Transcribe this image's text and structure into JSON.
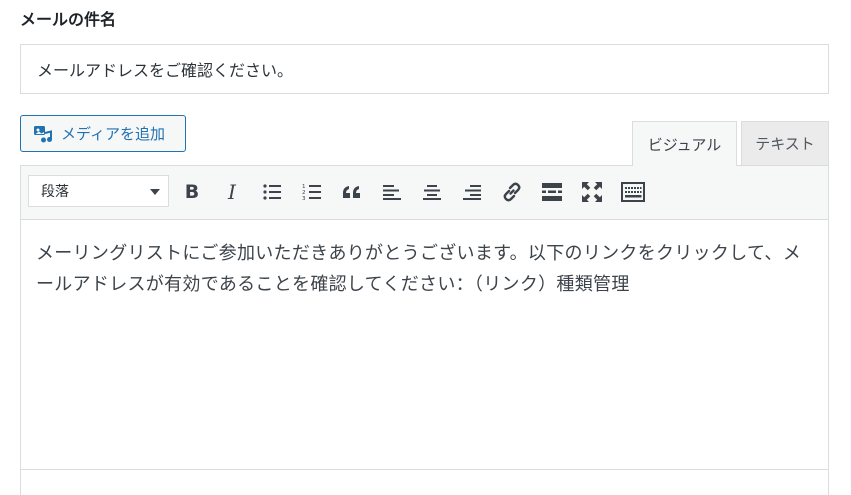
{
  "subject": {
    "label": "メールの件名",
    "value": "メールアドレスをご確認ください。"
  },
  "media": {
    "add_label": "メディアを追加"
  },
  "tabs": {
    "visual": "ビジュアル",
    "text": "テキスト"
  },
  "toolbar": {
    "format_selected": "段落",
    "bold_glyph": "B",
    "italic_glyph": "I"
  },
  "content": {
    "body": "メーリングリストにご参加いただきありがとうございます。以下のリンクをクリックして、メールアドレスが有効であることを確認してください：（リンク）種類管理"
  },
  "colors": {
    "accent": "#2271b1",
    "border": "#dcdcde",
    "toolbar_bg": "#f6f7f7"
  }
}
